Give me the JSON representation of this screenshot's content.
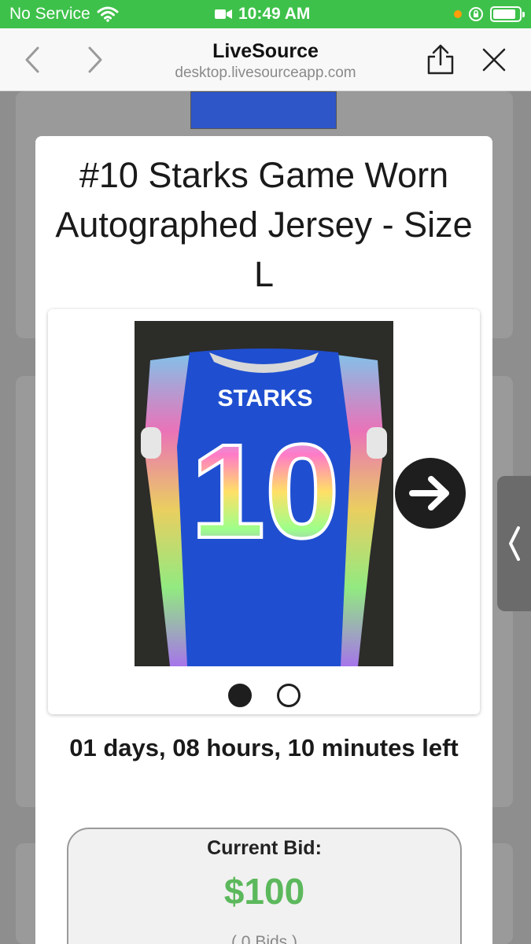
{
  "status_bar": {
    "carrier": "No Service",
    "time": "10:49 AM",
    "wifi_icon": "wifi-icon",
    "camera_icon": "video-camera-icon",
    "battery_icon": "battery-icon"
  },
  "nav": {
    "title": "LiveSource",
    "url": "desktop.livesourceapp.com",
    "icons": [
      "chevron-left-icon",
      "chevron-right-icon",
      "share-icon",
      "close-icon"
    ]
  },
  "item": {
    "title": "#10 Starks Game Worn Autographed Jersey - Size L",
    "photo": {
      "jersey_name": "STARKS",
      "jersey_number": "10"
    },
    "carousel": {
      "current_slide": 1,
      "total_slides": 2
    },
    "time_left": "01 days, 08 hours, 10 minutes left",
    "bid": {
      "label": "Current Bid:",
      "amount": "$100",
      "count": "( 0 Bids )"
    }
  },
  "colors": {
    "status_bar": "#3ec14a",
    "bid_amount": "#5cb85c",
    "jersey_blue": "#1f4fd0"
  }
}
